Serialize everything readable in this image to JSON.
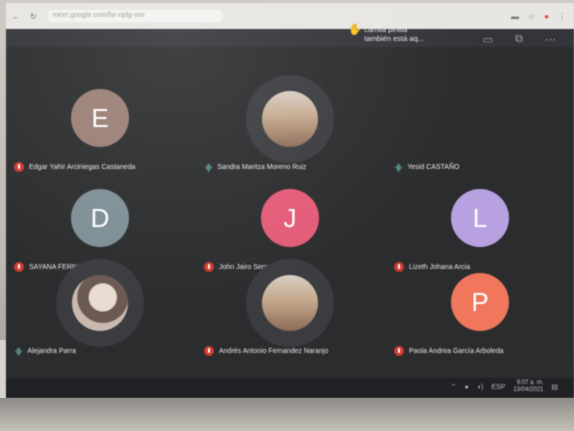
{
  "browser": {
    "url": "meet.google.com/fxr-njdg-vwr",
    "nav_icons": [
      "back-icon",
      "reload-icon"
    ],
    "ext_icons": [
      "extension-icon",
      "star-icon",
      "record-icon",
      "menu-icon"
    ]
  },
  "meeting": {
    "notice_line1": "camila pinilla",
    "notice_line2": "también está aq...",
    "top_icons": [
      "captions-icon",
      "present-icon",
      "more-icon"
    ]
  },
  "participants": [
    {
      "initial": "E",
      "name": "Edgar Yahir Arciniegas Castaneda",
      "mic": "muted",
      "color": "#9a7f75",
      "photo": false
    },
    {
      "initial": "",
      "name": "Sandra Maritza Moreno Ruiz",
      "mic": "speaking",
      "color": "#3b3c3f",
      "photo": true
    },
    {
      "initial": "",
      "name": "Yesid CASTAÑO",
      "mic": "speaking",
      "color": "#2b2c2e",
      "photo": false,
      "blank": true
    },
    {
      "initial": "D",
      "name": "SAYANA FERNANDEZ",
      "mic": "muted",
      "color": "#7d8f95",
      "photo": false
    },
    {
      "initial": "J",
      "name": "John Jairo Serna",
      "mic": "muted",
      "color": "#e35b77",
      "photo": false
    },
    {
      "initial": "L",
      "name": "Lizeth Johana Arcia",
      "mic": "muted",
      "color": "#b7a1e0",
      "photo": false
    },
    {
      "initial": "",
      "name": "Alejandra Parra",
      "mic": "speaking",
      "color": "#3b3c3f",
      "photo": true
    },
    {
      "initial": "",
      "name": "Andrés Antonio Fernandez Naranjo",
      "mic": "muted",
      "color": "#3b3c3f",
      "photo": true
    },
    {
      "initial": "P",
      "name": "Paola Andrea García Arboleda",
      "mic": "muted",
      "color": "#f0775c",
      "photo": false
    }
  ],
  "taskbar": {
    "lang": "ESP",
    "time": "9:07 a. m.",
    "date": "13/04/2021"
  }
}
